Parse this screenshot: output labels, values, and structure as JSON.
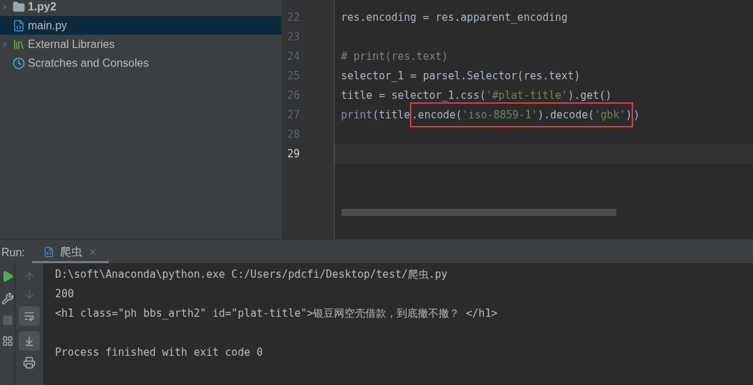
{
  "project_tree": [
    {
      "label": "1.py2",
      "kind": "folder",
      "selected": false,
      "expandable": true,
      "bold": true
    },
    {
      "label": "main.py",
      "kind": "pyfile",
      "selected": true,
      "expandable": false,
      "bold": false
    },
    {
      "label": "External Libraries",
      "kind": "libraries",
      "selected": false,
      "expandable": true,
      "bold": false
    },
    {
      "label": "Scratches and Consoles",
      "kind": "scratches",
      "selected": false,
      "expandable": false,
      "bold": false
    }
  ],
  "editor": {
    "lines": [
      {
        "number": "22",
        "current": false,
        "tokens": [
          {
            "text": "res.encoding = res.apparent_encoding",
            "kind": "plain"
          }
        ]
      },
      {
        "number": "23",
        "current": false
      },
      {
        "number": "24",
        "current": false,
        "tokens": [
          {
            "text": "# print(res.text)",
            "kind": "comment"
          }
        ]
      },
      {
        "number": "25",
        "current": false,
        "tokens": [
          {
            "text": "selector_1 = parsel.Selector(res.text)",
            "kind": "plain"
          }
        ]
      },
      {
        "number": "26",
        "current": false,
        "tokens": [
          {
            "text": "title = selector_1.css(",
            "kind": "plain"
          },
          {
            "text": "'#plat-title'",
            "kind": "string"
          },
          {
            "text": ").get()",
            "kind": "plain"
          }
        ]
      },
      {
        "number": "27",
        "current": false,
        "tokens": [
          {
            "text": "print",
            "kind": "builtin"
          },
          {
            "text": "(title",
            "kind": "plain"
          }
        ],
        "boxed": [
          {
            "text": ".encode(",
            "kind": "plain"
          },
          {
            "text": "'iso-8859-1'",
            "kind": "string"
          },
          {
            "text": ").decode(",
            "kind": "plain"
          },
          {
            "text": "'gbk'",
            "kind": "string"
          },
          {
            "text": ")",
            "kind": "plain"
          }
        ],
        "after": [
          {
            "text": ")",
            "kind": "plain"
          }
        ]
      },
      {
        "number": "28",
        "current": false
      },
      {
        "number": "29",
        "current": true
      }
    ]
  },
  "run_panel": {
    "label": "Run:",
    "tabs": [
      {
        "label": "爬虫",
        "selected": true
      }
    ],
    "console": [
      {
        "kind": "text",
        "text": "D:\\soft\\Anaconda\\python.exe C:/Users/pdcfi/Desktop/test/爬虫.py"
      },
      {
        "kind": "text",
        "text": "200"
      },
      {
        "kind": "text",
        "text": "<h1 class=\"ph bbs_arth2\" id=\"plat-title\">银豆网空壳借款，到底撤不撤？ </h1>"
      },
      {
        "kind": "blank"
      },
      {
        "kind": "text",
        "text": "Process finished with exit code 0"
      }
    ]
  }
}
